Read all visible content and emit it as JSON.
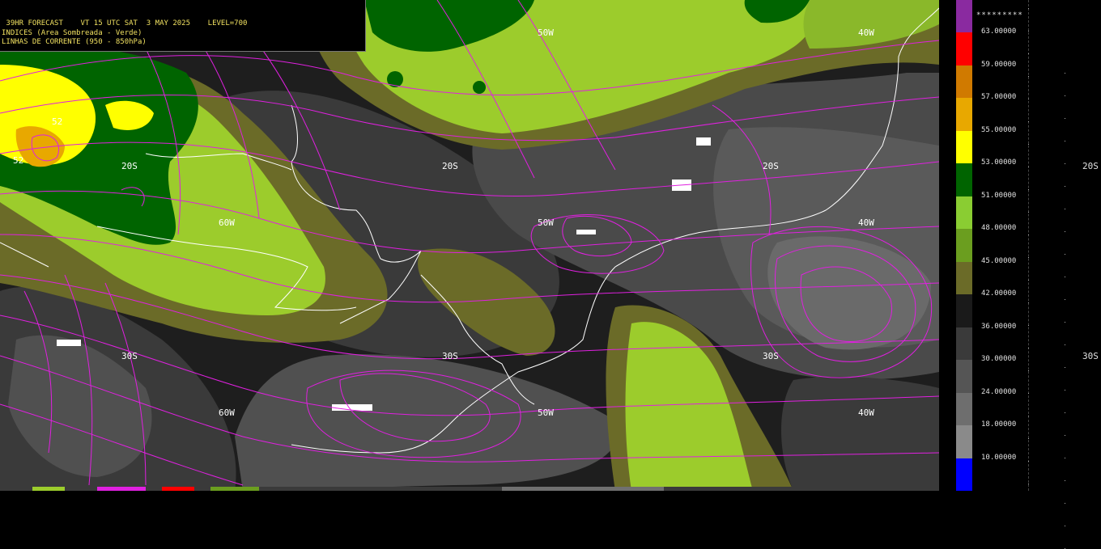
{
  "header": {
    "line1": " 39HR FORECAST    VT 15 UTC SAT  3 MAY 2025    LEVEL=700",
    "line2": "INDICES (Area Sombreada - Verde)",
    "line3": "LINHAS DE CORRENTE (950 - 850hPa)"
  },
  "map_labels": {
    "lat_20s": "20S",
    "lat_30s": "30S",
    "lon_60w": "60W",
    "lon_50w": "50W",
    "lon_40w": "40W",
    "contour_52": "52"
  },
  "colorbar": {
    "top_label": "*********",
    "levels": [
      "63.00000",
      "59.00000",
      "57.00000",
      "55.00000",
      "53.00000",
      "51.00000",
      "48.00000",
      "45.00000",
      "42.00000",
      "36.00000",
      "30.00000",
      "24.00000",
      "18.00000",
      "10.00000"
    ],
    "colors": [
      "#8a2aa0",
      "#ff0000",
      "#d07a00",
      "#e8a800",
      "#ffff00",
      "#006400",
      "#8acd32",
      "#6b9e1f",
      "#6b6b28",
      "#1a1a1a",
      "#3a3a3a",
      "#555555",
      "#6e6e6e",
      "#8a8a8a",
      "#0000ff"
    ]
  },
  "right_panel": {
    "lat_20s": "20S",
    "lat_30s": "30S"
  },
  "colors": {
    "streamline": "#e020e0",
    "coast": "#ffffff",
    "title_text": "#f0e060"
  }
}
